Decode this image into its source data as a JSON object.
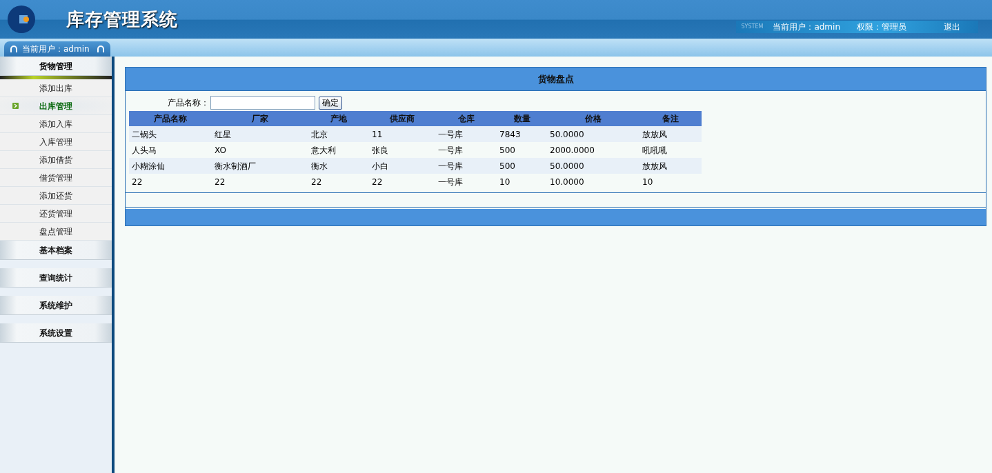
{
  "header": {
    "title": "库存管理系统",
    "current_user": "当前用户：admin",
    "role": "权限：管理员",
    "logout": "退出",
    "system_mark": "SYSTEM"
  },
  "user_tab": "当前用户：admin",
  "sidebar": {
    "groups": [
      {
        "label": "货物管理",
        "expanded": true,
        "items": [
          {
            "label": "添加出库",
            "selected": false
          },
          {
            "label": "出库管理",
            "selected": true
          },
          {
            "label": "添加入库",
            "selected": false
          },
          {
            "label": "入库管理",
            "selected": false
          },
          {
            "label": "添加借货",
            "selected": false
          },
          {
            "label": "借货管理",
            "selected": false
          },
          {
            "label": "添加还货",
            "selected": false
          },
          {
            "label": "还货管理",
            "selected": false
          },
          {
            "label": "盘点管理",
            "selected": false
          }
        ]
      },
      {
        "label": "基本档案",
        "expanded": false
      },
      {
        "label": "查询统计",
        "expanded": false
      },
      {
        "label": "系统维护",
        "expanded": false
      },
      {
        "label": "系统设置",
        "expanded": false
      }
    ]
  },
  "panel": {
    "title": "货物盘点",
    "search": {
      "label": "产品名称：",
      "button": "确定"
    },
    "table": {
      "columns": [
        "产品名称",
        "厂家",
        "产地",
        "供应商",
        "仓库",
        "数量",
        "价格",
        "备注"
      ],
      "rows": [
        [
          "二锅头",
          "红星",
          "北京",
          "11",
          "一号库",
          "7843",
          "50.0000",
          "放放风"
        ],
        [
          "人头马",
          "XO",
          "意大利",
          "张良",
          "一号库",
          "500",
          "2000.0000",
          "吼吼吼"
        ],
        [
          "小糊涂仙",
          "衡水制酒厂",
          "衡水",
          "小白",
          "一号库",
          "500",
          "50.0000",
          "放放风"
        ],
        [
          "22",
          "22",
          "22",
          "22",
          "一号库",
          "10",
          "10.0000",
          "10"
        ]
      ]
    }
  }
}
